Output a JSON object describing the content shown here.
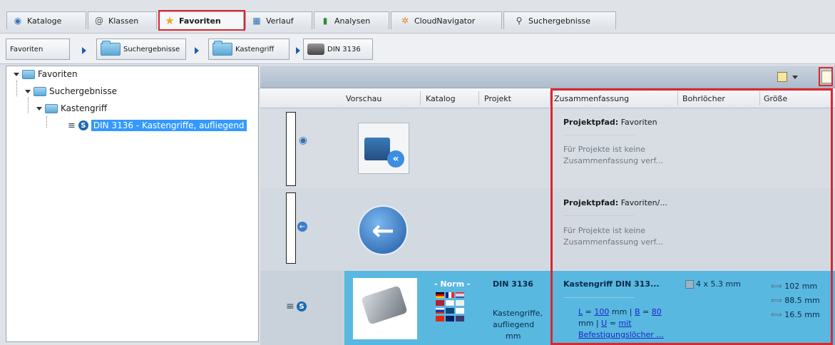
{
  "tabs": [
    {
      "label": "Kataloge",
      "icon": "catalog-icon"
    },
    {
      "label": "Klassen",
      "icon": "at-icon"
    },
    {
      "label": "Favoriten",
      "icon": "star-icon"
    },
    {
      "label": "Verlauf",
      "icon": "calendar-icon"
    },
    {
      "label": "Analysen",
      "icon": "bar-chart-icon"
    },
    {
      "label": "CloudNavigator",
      "icon": "cloud-network-icon"
    },
    {
      "label": "Suchergebnisse",
      "icon": "search-icon"
    }
  ],
  "breadcrumb": [
    "Favoriten",
    "Suchergebnisse",
    "Kastengriff",
    "DIN 3136"
  ],
  "tree": {
    "root": "Favoriten",
    "child": "Suchergebnisse",
    "grandchild": "Kastengriff",
    "leaf": "DIN 3136 - Kastengriffe, aufliegend"
  },
  "columns": [
    "Vorschau",
    "Katalog",
    "Projekt",
    "Zusammenfassung",
    "Bohrlöcher",
    "Größe"
  ],
  "rows": [
    {
      "summary_title_bold": "Projektpfad:",
      "summary_title_rest": " Favoriten",
      "summary_gray_1": "Für Projekte ist keine",
      "summary_gray_2": "Zusammenfassung verf..."
    },
    {
      "summary_title_bold": "Projektpfad:",
      "summary_title_rest": " Favoriten/...",
      "summary_gray_1": "Für Projekte ist keine",
      "summary_gray_2": "Zusammenfassung verf..."
    },
    {
      "katalog": "- Norm -",
      "projekt_title": "DIN 3136",
      "projekt_line1": "Kastengriffe,",
      "projekt_line2": "aufliegend",
      "projekt_line3": "mm",
      "summary_title": "Kastengriff DIN 313...",
      "formula_L": "L",
      "formula_L_eq": " = ",
      "formula_L_val": "100",
      "formula_mm1": " mm | ",
      "formula_B": "B",
      "formula_B_eq": " = ",
      "formula_B_val": "80",
      "formula_mm2": "mm | ",
      "formula_U": "U",
      "formula_U_eq": " = ",
      "formula_U_val": "mit",
      "formula_tail": "Befestigungslöcher ...",
      "bohrloecher": "4 x 5.3 mm",
      "groesse_1": "102 mm",
      "groesse_2": "88.5 mm",
      "groesse_3": "16.5 mm"
    }
  ],
  "colors": {
    "highlight": "#e0242b",
    "selection": "#3399ff",
    "rowActive": "#59b8e0"
  }
}
